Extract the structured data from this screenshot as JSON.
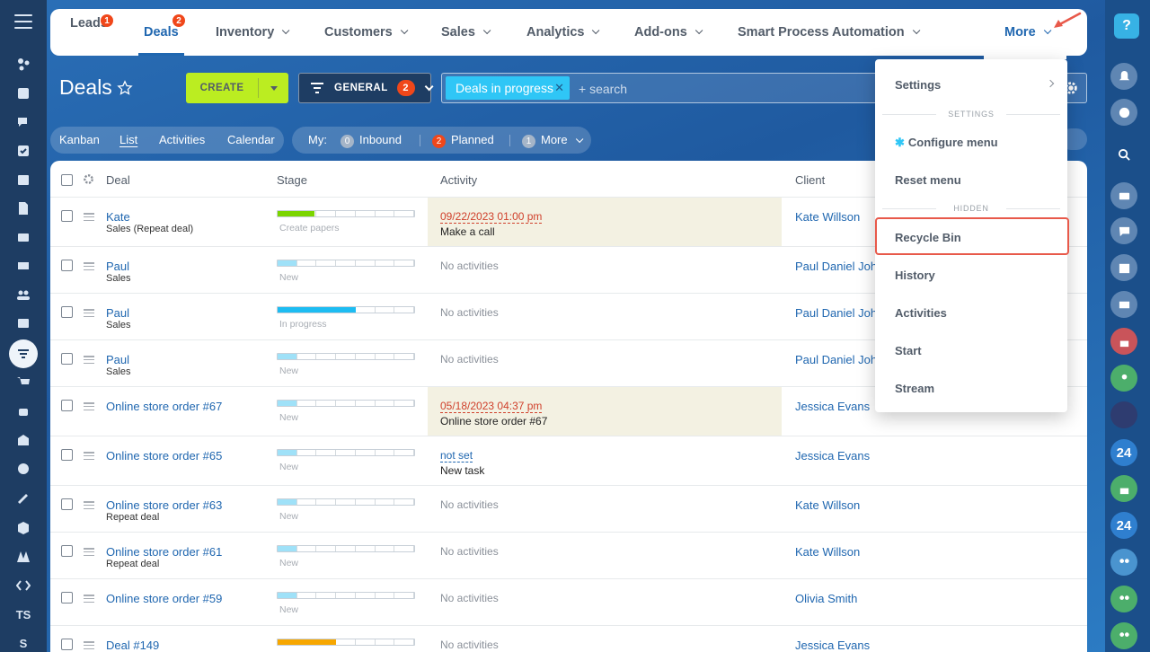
{
  "nav": {
    "items": [
      {
        "label": "Leads",
        "badge": "1"
      },
      {
        "label": "Deals",
        "badge": "2"
      },
      {
        "label": "Inventory"
      },
      {
        "label": "Customers"
      },
      {
        "label": "Sales"
      },
      {
        "label": "Analytics"
      },
      {
        "label": "Add-ons"
      },
      {
        "label": "Smart Process Automation"
      }
    ],
    "more_label": "More"
  },
  "header": {
    "title": "Deals",
    "create_label": "CREATE",
    "general_label": "GENERAL",
    "general_count": "2",
    "filter_chip": "Deals in progress",
    "search_placeholder": "+ search"
  },
  "views": {
    "tabs": [
      "Kanban",
      "List",
      "Activities",
      "Calendar"
    ],
    "active": "List"
  },
  "my_filter": {
    "label": "My:",
    "inbound_count": "0",
    "inbound_label": "Inbound",
    "planned_count": "2",
    "planned_label": "Planned",
    "more_count": "1",
    "more_label": "More"
  },
  "table": {
    "columns": {
      "deal": "Deal",
      "stage": "Stage",
      "activity": "Activity",
      "client": "Client"
    },
    "rows": [
      {
        "title": "Kate",
        "sub": "Sales (Repeat deal)",
        "stage_label": "Create papers",
        "stage_fill": 0.27,
        "stage_color": "#7bd500",
        "activity_date": "09/22/2023 01:00 pm",
        "activity_text": "Make a call",
        "client": "Kate Willson"
      },
      {
        "title": "Paul",
        "sub": "Sales",
        "stage_label": "New",
        "stage_fill": 0.14,
        "stage_color": "#9fe1f8",
        "activity_none": "No activities",
        "client": "Paul Daniel Johnson"
      },
      {
        "title": "Paul",
        "sub": "Sales",
        "stage_label": "In progress",
        "stage_fill": 0.57,
        "stage_color": "#1dbcf2",
        "activity_none": "No activities",
        "client": "Paul Daniel Johnson"
      },
      {
        "title": "Paul",
        "sub": "Sales",
        "stage_label": "New",
        "stage_fill": 0.14,
        "stage_color": "#9fe1f8",
        "activity_none": "No activities",
        "client": "Paul Daniel Johnson"
      },
      {
        "title": "Online store order #67",
        "sub": "",
        "stage_label": "New",
        "stage_fill": 0.14,
        "stage_color": "#9fe1f8",
        "activity_date": "05/18/2023 04:37 pm",
        "activity_text": "Online store order #67",
        "client": "Jessica Evans"
      },
      {
        "title": "Online store order #65",
        "sub": "",
        "stage_label": "New",
        "stage_fill": 0.14,
        "stage_color": "#9fe1f8",
        "activity_notset": "not set",
        "activity_text": "New task",
        "client": "Jessica Evans"
      },
      {
        "title": "Online store order #63",
        "sub": "Repeat deal",
        "stage_label": "New",
        "stage_fill": 0.14,
        "stage_color": "#9fe1f8",
        "activity_none": "No activities",
        "client": "Kate Willson"
      },
      {
        "title": "Online store order #61",
        "sub": "Repeat deal",
        "stage_label": "New",
        "stage_fill": 0.14,
        "stage_color": "#9fe1f8",
        "activity_none": "No activities",
        "client": "Kate Willson"
      },
      {
        "title": "Online store order #59",
        "sub": "",
        "stage_label": "New",
        "stage_fill": 0.14,
        "stage_color": "#9fe1f8",
        "activity_none": "No activities",
        "client": "Olivia Smith"
      },
      {
        "title": "Deal #149",
        "sub": "",
        "stage_label": "",
        "stage_fill": 0.43,
        "stage_color": "#f7a700",
        "activity_none": "No activities",
        "client": "Jessica Evans"
      }
    ]
  },
  "more_menu": {
    "settings": "Settings",
    "section_settings": "SETTINGS",
    "configure": "Configure menu",
    "reset": "Reset menu",
    "section_hidden": "HIDDEN",
    "recycle": "Recycle Bin",
    "history": "History",
    "activities": "Activities",
    "start": "Start",
    "stream": "Stream"
  },
  "left_bar": {
    "ts_label": "TS",
    "s_label": "S"
  },
  "right_bar": {
    "help": "?",
    "badge_24": "24"
  },
  "colors": {
    "accent": "#2067b0",
    "create": "#bbed21",
    "highlight": "#e8594a",
    "badge": "#f0471a"
  }
}
